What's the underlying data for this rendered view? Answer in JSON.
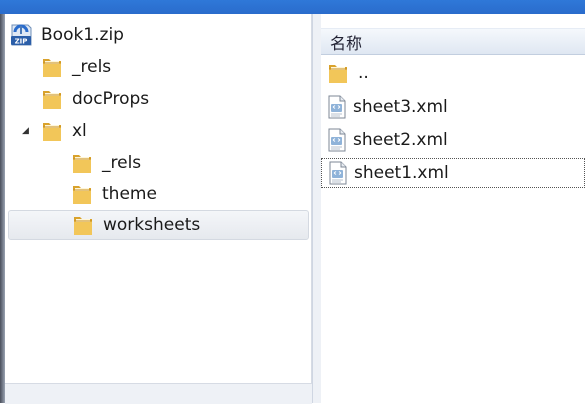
{
  "tree": {
    "items": [
      {
        "label": "Book1.zip",
        "icon": "zip-archive-icon"
      },
      {
        "label": "_rels",
        "icon": "folder-icon"
      },
      {
        "label": "docProps",
        "icon": "folder-icon"
      },
      {
        "label": "xl",
        "icon": "folder-icon",
        "expanded": true
      },
      {
        "label": "_rels",
        "icon": "folder-icon"
      },
      {
        "label": "theme",
        "icon": "folder-icon"
      },
      {
        "label": "worksheets",
        "icon": "folder-icon",
        "selected": true
      }
    ]
  },
  "list": {
    "column_header": "名称",
    "items": [
      {
        "label": "..",
        "icon": "folder-icon"
      },
      {
        "label": "sheet3.xml",
        "icon": "xml-file-icon"
      },
      {
        "label": "sheet2.xml",
        "icon": "xml-file-icon"
      },
      {
        "label": "sheet1.xml",
        "icon": "xml-file-icon",
        "focused": true
      }
    ]
  },
  "colors": {
    "titlebar": "#2f78d8",
    "folder": "#e9b849",
    "selection": "#e6e9ee"
  }
}
